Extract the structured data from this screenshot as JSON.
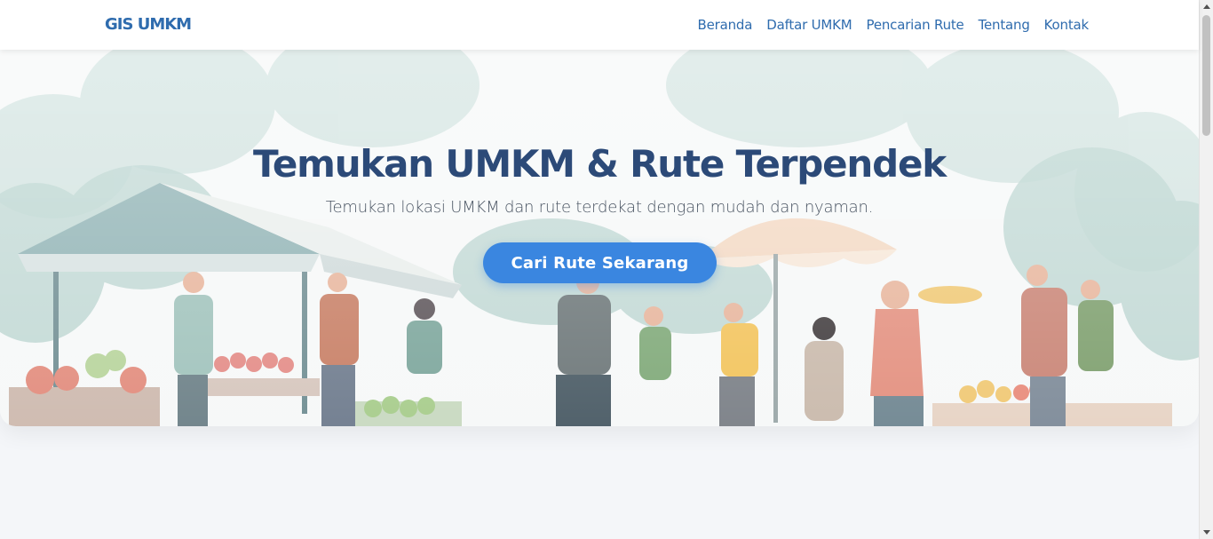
{
  "navbar": {
    "brand": "GIS UMKM",
    "links": [
      "Beranda",
      "Daftar UMKM",
      "Pencarian Rute",
      "Tentang",
      "Kontak"
    ]
  },
  "hero": {
    "title": "Temukan UMKM & Rute Terpendek",
    "subtitle": "Temukan lokasi UMKM dan rute terdekat dengan mudah dan nyaman.",
    "cta_label": "Cari Rute Sekarang"
  },
  "colors": {
    "brand": "#2f6cae",
    "title": "#2c4a78",
    "cta": "#3a86e0",
    "page_bg": "#f4f6f9"
  }
}
